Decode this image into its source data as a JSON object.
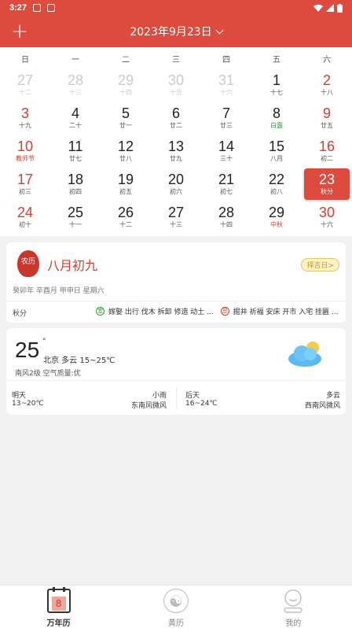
{
  "status_bar": {
    "time": "3:27"
  },
  "header": {
    "title": "2023年9月23日"
  },
  "weekdays": [
    "日",
    "一",
    "二",
    "三",
    "四",
    "五",
    "六"
  ],
  "days": [
    {
      "d": "27",
      "l": "十二",
      "type": "other"
    },
    {
      "d": "28",
      "l": "十三",
      "type": "other"
    },
    {
      "d": "29",
      "l": "十四",
      "type": "other"
    },
    {
      "d": "30",
      "l": "十五",
      "type": "other"
    },
    {
      "d": "31",
      "l": "十六",
      "type": "other"
    },
    {
      "d": "1",
      "l": "十七",
      "type": "normal"
    },
    {
      "d": "2",
      "l": "十八",
      "type": "weekend"
    },
    {
      "d": "3",
      "l": "十九",
      "type": "weekend"
    },
    {
      "d": "4",
      "l": "二十",
      "type": "normal"
    },
    {
      "d": "5",
      "l": "廿一",
      "type": "normal"
    },
    {
      "d": "6",
      "l": "廿二",
      "type": "normal"
    },
    {
      "d": "7",
      "l": "廿三",
      "type": "normal"
    },
    {
      "d": "8",
      "l": "白露",
      "type": "green"
    },
    {
      "d": "9",
      "l": "廿五",
      "type": "weekend"
    },
    {
      "d": "10",
      "l": "教师节",
      "type": "weekend-red"
    },
    {
      "d": "11",
      "l": "廿七",
      "type": "normal"
    },
    {
      "d": "12",
      "l": "廿八",
      "type": "normal"
    },
    {
      "d": "13",
      "l": "廿九",
      "type": "normal"
    },
    {
      "d": "14",
      "l": "三十",
      "type": "normal"
    },
    {
      "d": "15",
      "l": "八月",
      "type": "normal"
    },
    {
      "d": "16",
      "l": "初二",
      "type": "weekend"
    },
    {
      "d": "17",
      "l": "初三",
      "type": "weekend"
    },
    {
      "d": "18",
      "l": "初四",
      "type": "normal"
    },
    {
      "d": "19",
      "l": "初五",
      "type": "normal"
    },
    {
      "d": "20",
      "l": "初六",
      "type": "normal"
    },
    {
      "d": "21",
      "l": "初七",
      "type": "normal"
    },
    {
      "d": "22",
      "l": "初八",
      "type": "normal"
    },
    {
      "d": "23",
      "l": "秋分",
      "type": "selected"
    },
    {
      "d": "24",
      "l": "初十",
      "type": "weekend"
    },
    {
      "d": "25",
      "l": "十一",
      "type": "normal"
    },
    {
      "d": "26",
      "l": "十二",
      "type": "normal"
    },
    {
      "d": "27",
      "l": "十三",
      "type": "normal"
    },
    {
      "d": "28",
      "l": "十四",
      "type": "normal"
    },
    {
      "d": "29",
      "l": "中秋",
      "type": "red"
    },
    {
      "d": "30",
      "l": "十六",
      "type": "weekend"
    }
  ],
  "almanac": {
    "seal_text": "农历",
    "lunar_date": "八月初九",
    "pill": "择吉日>",
    "ganzhi": "癸卯年 辛酉月 甲申日 星期六",
    "solar_term": "秋分",
    "yi_badge": "宜",
    "yi": "嫁娶 出行 伐木 拆卸 修造 动土 ...",
    "ji_badge": "忌",
    "ji": "掘井 祈福 安床 开市 入宅 挂匾 ..."
  },
  "weather": {
    "temp": "25",
    "deg": "°",
    "desc": "北京 多云 15~25℃",
    "sub": "南风2级 空气质量:优",
    "tomorrow_label": "明天",
    "tomorrow_cond": "小雨",
    "tomorrow_range": "13~20℃",
    "tomorrow_wind": "东南风微风",
    "after_label": "后天",
    "after_cond": "多云",
    "after_range": "16~24℃",
    "after_wind": "西南风微风"
  },
  "tabs": [
    {
      "label": "万年历",
      "icon": "calendar-icon",
      "num": "8"
    },
    {
      "label": "黄历",
      "icon": "yin-yang-icon"
    },
    {
      "label": "我的",
      "icon": "profile-icon"
    }
  ],
  "colors": {
    "primary": "#dc4b3e",
    "weekend": "#d63b30",
    "solar_term": "#2e9a3a"
  }
}
